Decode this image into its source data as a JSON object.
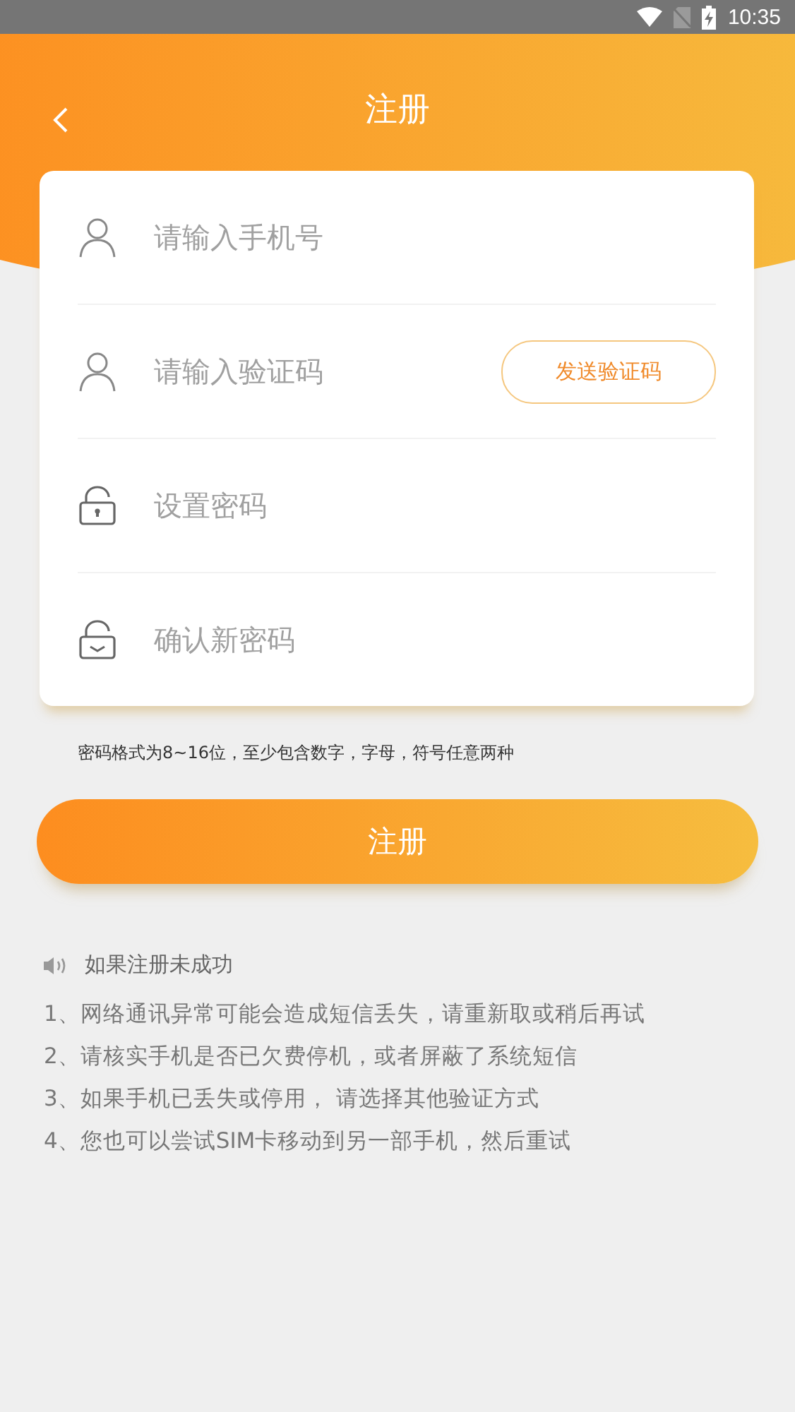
{
  "status_bar": {
    "time": "10:35"
  },
  "header": {
    "title": "注册"
  },
  "fields": [
    {
      "kind": "account",
      "placeholder": "请输入手机号"
    },
    {
      "kind": "code",
      "placeholder": "请输入验证码",
      "button": "发送验证码"
    },
    {
      "kind": "password",
      "placeholder": "设置密码"
    },
    {
      "kind": "confirm",
      "placeholder": "确认新密码"
    }
  ],
  "password_hint": "密码格式为8~16位，至少包含数字，字母，符号任意两种",
  "submit_button": "注册",
  "tips": {
    "title": "如果注册未成功",
    "items": [
      "1、网络通讯异常可能会造成短信丢失，请重新取或稍后再试",
      "2、请核实手机是否已欠费停机，或者屏蔽了系统短信",
      "3、如果手机已丢失或停用， 请选择其他验证方式",
      "4、您也可以尝试SIM卡移动到另一部手机，然后重试"
    ]
  }
}
